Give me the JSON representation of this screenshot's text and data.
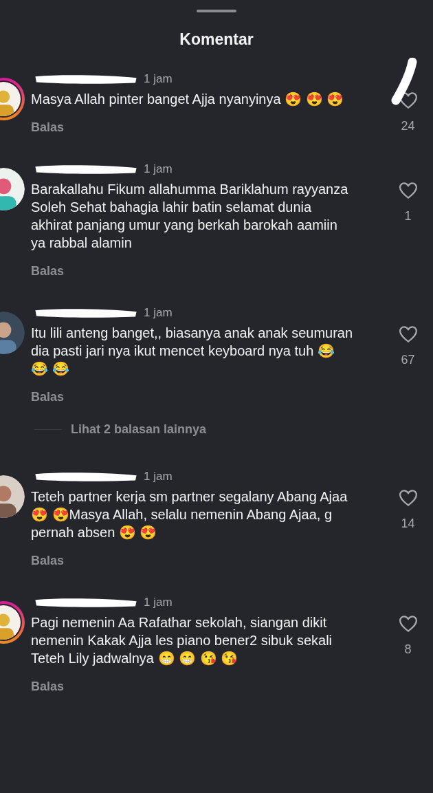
{
  "sheet": {
    "title": "Komentar"
  },
  "comments": [
    {
      "avatar": {
        "kind": "picture",
        "story_ring": true
      },
      "time": "1 jam",
      "text": "Masya Allah pinter banget Ajja nyanyinya 😍 😍 😍",
      "reply": "Balas",
      "liked": false,
      "likes": "24"
    },
    {
      "avatar": {
        "kind": "picture",
        "story_ring": false
      },
      "time": "1 jam",
      "text": "Barakallahu Fikum allahumma Bariklahum rayyanza Soleh Sehat bahagia lahir batin selamat dunia akhirat panjang umur yang berkah barokah aamiin ya rabbal alamin",
      "reply": "Balas",
      "liked": false,
      "likes": "1"
    },
    {
      "avatar": {
        "kind": "picture",
        "story_ring": false
      },
      "time": "1 jam",
      "text": "Itu lili anteng banget,, biasanya anak anak seumuran dia pasti jari nya ikut mencet keyboard nya tuh 😂 😂 😂",
      "reply": "Balas",
      "liked": false,
      "likes": "67",
      "more_replies": "Lihat 2 balasan lainnya"
    },
    {
      "avatar": {
        "kind": "picture",
        "story_ring": false
      },
      "time": "1 jam",
      "text": "Teteh partner kerja sm partner segalany Abang Ajaa 😍  😍Masya Allah, selalu nemenin Abang Ajaa, g pernah absen 😍  😍",
      "reply": "Balas",
      "liked": false,
      "likes": "14"
    },
    {
      "avatar": {
        "kind": "picture",
        "story_ring": true
      },
      "time": "1 jam",
      "text": "Pagi nemenin Aa Rafathar sekolah, siangan dikit nemenin Kakak Ajja les piano bener2 sibuk sekali Teteh Lily jadwalnya 😁 😁 😘 😘",
      "reply": "Balas",
      "liked": false,
      "likes": "8"
    }
  ]
}
